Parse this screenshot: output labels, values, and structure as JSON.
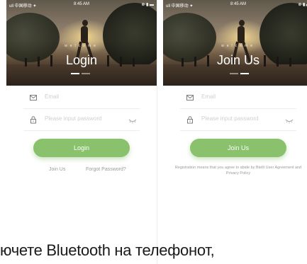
{
  "status_bar": {
    "carrier": "ull 中国移动 ✦",
    "time": "8:45 AM",
    "right": "⊕ ▮ ▬"
  },
  "screens": [
    {
      "welcome": "welcome",
      "title": "Login",
      "email_placeholder": "Email",
      "password_placeholder": "Please input password",
      "button_label": "Login",
      "link_join": "Join Us",
      "link_forgot": "Forgot Password?"
    },
    {
      "welcome": "welcome",
      "title": "Join Us",
      "email_placeholder": "Email",
      "password_placeholder": "Please input password",
      "button_label": "Join Us",
      "terms": "Registration means that you agree to abide by Btellt User Agreement and Privacy Policy"
    }
  ],
  "caption": "ючете Bluetooth на телефонот,",
  "colors": {
    "accent": "#8ac16d",
    "hint": "#cfcfcf",
    "divider": "#ededed"
  },
  "icons": {
    "email": "envelope-icon",
    "password": "lock-icon",
    "visibility": "eye-closed-icon"
  }
}
